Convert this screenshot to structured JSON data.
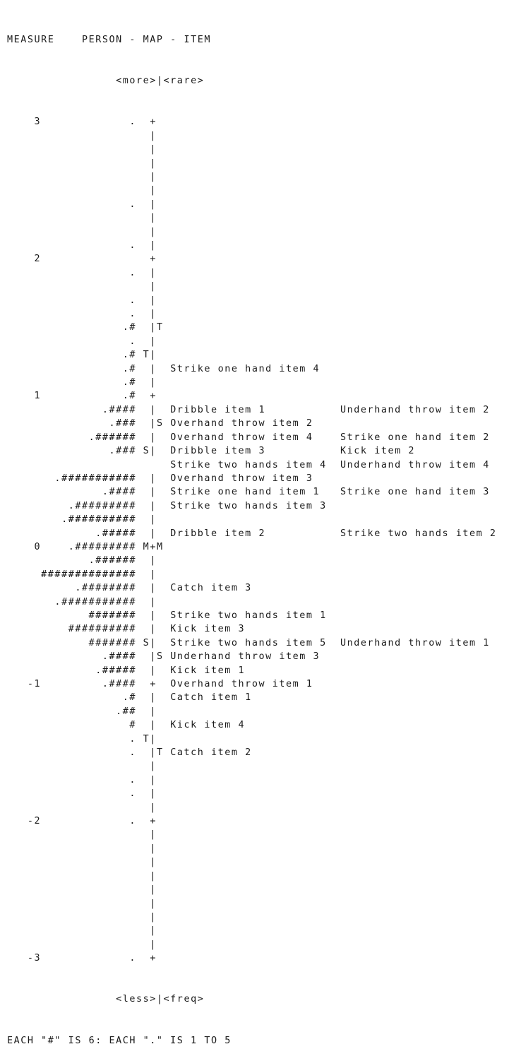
{
  "chart_data": {
    "type": "table",
    "title": "PERSON - MAP - ITEM",
    "measure_label": "MEASURE",
    "top_labels": {
      "person": "<more>",
      "item": "<rare>"
    },
    "bottom_labels": {
      "person": "<less>",
      "item": "<freq>"
    },
    "legend": "EACH \"#\" IS 6: EACH \".\" IS 1 TO 5",
    "y_range": [
      -3,
      3
    ],
    "y_ticks": [
      "3",
      "2",
      "1",
      "0",
      "-1",
      "-2",
      "-3"
    ],
    "rows": [
      {
        "measure": "3",
        "persons": ".",
        "lmark": " ",
        "axis": "+",
        "rmark": " ",
        "items": []
      },
      {
        "measure": "",
        "persons": "",
        "lmark": " ",
        "axis": "|",
        "rmark": " ",
        "items": []
      },
      {
        "measure": "",
        "persons": "",
        "lmark": " ",
        "axis": "|",
        "rmark": " ",
        "items": []
      },
      {
        "measure": "",
        "persons": "",
        "lmark": " ",
        "axis": "|",
        "rmark": " ",
        "items": []
      },
      {
        "measure": "",
        "persons": "",
        "lmark": " ",
        "axis": "|",
        "rmark": " ",
        "items": []
      },
      {
        "measure": "",
        "persons": "",
        "lmark": " ",
        "axis": "|",
        "rmark": " ",
        "items": []
      },
      {
        "measure": "",
        "persons": ".",
        "lmark": " ",
        "axis": "|",
        "rmark": " ",
        "items": []
      },
      {
        "measure": "",
        "persons": "",
        "lmark": " ",
        "axis": "|",
        "rmark": " ",
        "items": []
      },
      {
        "measure": "",
        "persons": "",
        "lmark": " ",
        "axis": "|",
        "rmark": " ",
        "items": []
      },
      {
        "measure": "",
        "persons": ".",
        "lmark": " ",
        "axis": "|",
        "rmark": " ",
        "items": []
      },
      {
        "measure": "2",
        "persons": "",
        "lmark": " ",
        "axis": "+",
        "rmark": " ",
        "items": []
      },
      {
        "measure": "",
        "persons": ".",
        "lmark": " ",
        "axis": "|",
        "rmark": " ",
        "items": []
      },
      {
        "measure": "",
        "persons": "",
        "lmark": " ",
        "axis": "|",
        "rmark": " ",
        "items": []
      },
      {
        "measure": "",
        "persons": ".",
        "lmark": " ",
        "axis": "|",
        "rmark": " ",
        "items": []
      },
      {
        "measure": "",
        "persons": ".",
        "lmark": " ",
        "axis": "|",
        "rmark": " ",
        "items": []
      },
      {
        "measure": "",
        "persons": ".#",
        "lmark": " ",
        "axis": "|",
        "rmark": "T",
        "items": []
      },
      {
        "measure": "",
        "persons": ".",
        "lmark": " ",
        "axis": "|",
        "rmark": " ",
        "items": []
      },
      {
        "measure": "",
        "persons": ".#",
        "lmark": "T",
        "axis": "|",
        "rmark": " ",
        "items": []
      },
      {
        "measure": "",
        "persons": ".#",
        "lmark": " ",
        "axis": "|",
        "rmark": " ",
        "items": [
          "Strike one hand item 4"
        ]
      },
      {
        "measure": "",
        "persons": ".#",
        "lmark": " ",
        "axis": "|",
        "rmark": " ",
        "items": []
      },
      {
        "measure": "1",
        "persons": ".#",
        "lmark": " ",
        "axis": "+",
        "rmark": " ",
        "items": []
      },
      {
        "measure": "",
        "persons": ".####",
        "lmark": " ",
        "axis": "|",
        "rmark": " ",
        "items": [
          "Dribble item 1",
          "Underhand throw item 2"
        ]
      },
      {
        "measure": "",
        "persons": ".###",
        "lmark": " ",
        "axis": "|",
        "rmark": "S",
        "items": [
          "Overhand throw item 2"
        ]
      },
      {
        "measure": "",
        "persons": ".######",
        "lmark": " ",
        "axis": "|",
        "rmark": " ",
        "items": [
          "Overhand throw item 4",
          "Strike one hand item 2"
        ]
      },
      {
        "measure": "",
        "persons": ".###",
        "lmark": "S",
        "axis": "|",
        "rmark": " ",
        "items": [
          "Dribble item 3",
          "Kick item 2"
        ]
      },
      {
        "measure": "",
        "persons": "",
        "lmark": " ",
        "axis": " ",
        "rmark": " ",
        "items": [
          "Strike two hands item 4",
          "Underhand throw item 4"
        ]
      },
      {
        "measure": "",
        "persons": ".###########",
        "lmark": " ",
        "axis": "|",
        "rmark": " ",
        "items": [
          "Overhand throw item 3"
        ]
      },
      {
        "measure": "",
        "persons": ".####",
        "lmark": " ",
        "axis": "|",
        "rmark": " ",
        "items": [
          "Strike one hand item 1",
          "Strike one hand item 3"
        ]
      },
      {
        "measure": "",
        "persons": ".#########",
        "lmark": " ",
        "axis": "|",
        "rmark": " ",
        "items": [
          "Strike two hands item 3"
        ]
      },
      {
        "measure": "",
        "persons": ".##########",
        "lmark": " ",
        "axis": "|",
        "rmark": " ",
        "items": []
      },
      {
        "measure": "",
        "persons": ".#####",
        "lmark": " ",
        "axis": "|",
        "rmark": " ",
        "items": [
          "Dribble item 2",
          "Strike two hands item 2"
        ]
      },
      {
        "measure": "0",
        "persons": ".#########",
        "lmark": "M",
        "axis": "+",
        "rmark": "M",
        "items": []
      },
      {
        "measure": "",
        "persons": ".######",
        "lmark": " ",
        "axis": "|",
        "rmark": " ",
        "items": []
      },
      {
        "measure": "",
        "persons": "##############",
        "lmark": " ",
        "axis": "|",
        "rmark": " ",
        "items": []
      },
      {
        "measure": "",
        "persons": ".########",
        "lmark": " ",
        "axis": "|",
        "rmark": " ",
        "items": [
          "Catch item 3"
        ]
      },
      {
        "measure": "",
        "persons": ".###########",
        "lmark": " ",
        "axis": "|",
        "rmark": " ",
        "items": []
      },
      {
        "measure": "",
        "persons": "#######",
        "lmark": " ",
        "axis": "|",
        "rmark": " ",
        "items": [
          "Strike two hands item 1"
        ]
      },
      {
        "measure": "",
        "persons": "##########",
        "lmark": " ",
        "axis": "|",
        "rmark": " ",
        "items": [
          "Kick item 3"
        ]
      },
      {
        "measure": "",
        "persons": "#######",
        "lmark": "S",
        "axis": "|",
        "rmark": " ",
        "items": [
          "Strike two hands item 5",
          "Underhand throw item 1"
        ]
      },
      {
        "measure": "",
        "persons": ".####",
        "lmark": " ",
        "axis": "|",
        "rmark": "S",
        "items": [
          "Underhand throw item 3"
        ]
      },
      {
        "measure": "",
        "persons": ".#####",
        "lmark": " ",
        "axis": "|",
        "rmark": " ",
        "items": [
          "Kick item 1"
        ]
      },
      {
        "measure": "-1",
        "persons": ".####",
        "lmark": " ",
        "axis": "+",
        "rmark": " ",
        "items": [
          "Overhand throw item 1"
        ]
      },
      {
        "measure": "",
        "persons": ".#",
        "lmark": " ",
        "axis": "|",
        "rmark": " ",
        "items": [
          "Catch item 1"
        ]
      },
      {
        "measure": "",
        "persons": ".##",
        "lmark": " ",
        "axis": "|",
        "rmark": " ",
        "items": []
      },
      {
        "measure": "",
        "persons": "#",
        "lmark": " ",
        "axis": "|",
        "rmark": " ",
        "items": [
          "Kick item 4"
        ]
      },
      {
        "measure": "",
        "persons": ".",
        "lmark": "T",
        "axis": "|",
        "rmark": " ",
        "items": []
      },
      {
        "measure": "",
        "persons": ".",
        "lmark": " ",
        "axis": "|",
        "rmark": "T",
        "items": [
          "Catch item 2"
        ]
      },
      {
        "measure": "",
        "persons": "",
        "lmark": " ",
        "axis": "|",
        "rmark": " ",
        "items": []
      },
      {
        "measure": "",
        "persons": ".",
        "lmark": " ",
        "axis": "|",
        "rmark": " ",
        "items": []
      },
      {
        "measure": "",
        "persons": ".",
        "lmark": " ",
        "axis": "|",
        "rmark": " ",
        "items": []
      },
      {
        "measure": "",
        "persons": "",
        "lmark": " ",
        "axis": "|",
        "rmark": " ",
        "items": []
      },
      {
        "measure": "-2",
        "persons": ".",
        "lmark": " ",
        "axis": "+",
        "rmark": " ",
        "items": []
      },
      {
        "measure": "",
        "persons": "",
        "lmark": " ",
        "axis": "|",
        "rmark": " ",
        "items": []
      },
      {
        "measure": "",
        "persons": "",
        "lmark": " ",
        "axis": "|",
        "rmark": " ",
        "items": []
      },
      {
        "measure": "",
        "persons": "",
        "lmark": " ",
        "axis": "|",
        "rmark": " ",
        "items": []
      },
      {
        "measure": "",
        "persons": "",
        "lmark": " ",
        "axis": "|",
        "rmark": " ",
        "items": []
      },
      {
        "measure": "",
        "persons": "",
        "lmark": " ",
        "axis": "|",
        "rmark": " ",
        "items": []
      },
      {
        "measure": "",
        "persons": "",
        "lmark": " ",
        "axis": "|",
        "rmark": " ",
        "items": []
      },
      {
        "measure": "",
        "persons": "",
        "lmark": " ",
        "axis": "|",
        "rmark": " ",
        "items": []
      },
      {
        "measure": "",
        "persons": "",
        "lmark": " ",
        "axis": "|",
        "rmark": " ",
        "items": []
      },
      {
        "measure": "",
        "persons": "",
        "lmark": " ",
        "axis": "|",
        "rmark": " ",
        "items": []
      },
      {
        "measure": "-3",
        "persons": ".",
        "lmark": " ",
        "axis": "+",
        "rmark": " ",
        "items": []
      }
    ]
  }
}
